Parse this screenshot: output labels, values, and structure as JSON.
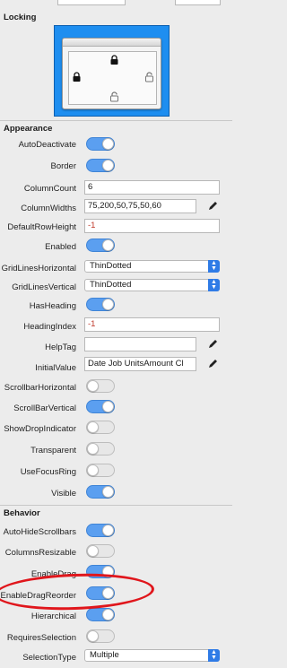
{
  "locking": {
    "title": "Locking"
  },
  "appearance": {
    "title": "Appearance",
    "AutoDeactivate": true,
    "Border": true,
    "ColumnCount": "6",
    "ColumnWidths": "75,200,50,75,50,60",
    "DefaultRowHeight": "-1",
    "Enabled": true,
    "GridLinesHorizontal": "ThinDotted",
    "GridLinesVertical": "ThinDotted",
    "HasHeading": true,
    "HeadingIndex": "-1",
    "HelpTag": "",
    "InitialValue": "Date Job  UnitsAmount    Cl",
    "ScrollbarHorizontal": false,
    "ScrollBarVertical": true,
    "ShowDropIndicator": false,
    "Transparent": false,
    "UseFocusRing": false,
    "Visible": true
  },
  "behavior": {
    "title": "Behavior",
    "AutoHideScrollbars": true,
    "ColumnsResizable": false,
    "EnableDrag": true,
    "EnableDragReorder": true,
    "Hierarchical": true,
    "RequiresSelection": false,
    "SelectionType": "Multiple"
  },
  "labels": {
    "AutoDeactivate": "AutoDeactivate",
    "Border": "Border",
    "ColumnCount": "ColumnCount",
    "ColumnWidths": "ColumnWidths",
    "DefaultRowHeight": "DefaultRowHeight",
    "Enabled": "Enabled",
    "GridLinesHorizontal": "GridLinesHorizontal",
    "GridLinesVertical": "GridLinesVertical",
    "HasHeading": "HasHeading",
    "HeadingIndex": "HeadingIndex",
    "HelpTag": "HelpTag",
    "InitialValue": "InitialValue",
    "ScrollbarHorizontal": "ScrollbarHorizontal",
    "ScrollBarVertical": "ScrollBarVertical",
    "ShowDropIndicator": "ShowDropIndicator",
    "Transparent": "Transparent",
    "UseFocusRing": "UseFocusRing",
    "Visible": "Visible",
    "AutoHideScrollbars": "AutoHideScrollbars",
    "ColumnsResizable": "ColumnsResizable",
    "EnableDrag": "EnableDrag",
    "EnableDragReorder": "EnableDragReorder",
    "Hierarchical": "Hierarchical",
    "RequiresSelection": "RequiresSelection",
    "SelectionType": "SelectionType"
  },
  "colors": {
    "toggle_on": "#5b9ff0",
    "lock_bg": "#1e8ef0",
    "highlight": "#e0161c"
  },
  "icons": {
    "pencil": "pencil-icon",
    "lock": "lock-icon",
    "unlock": "unlock-icon"
  }
}
